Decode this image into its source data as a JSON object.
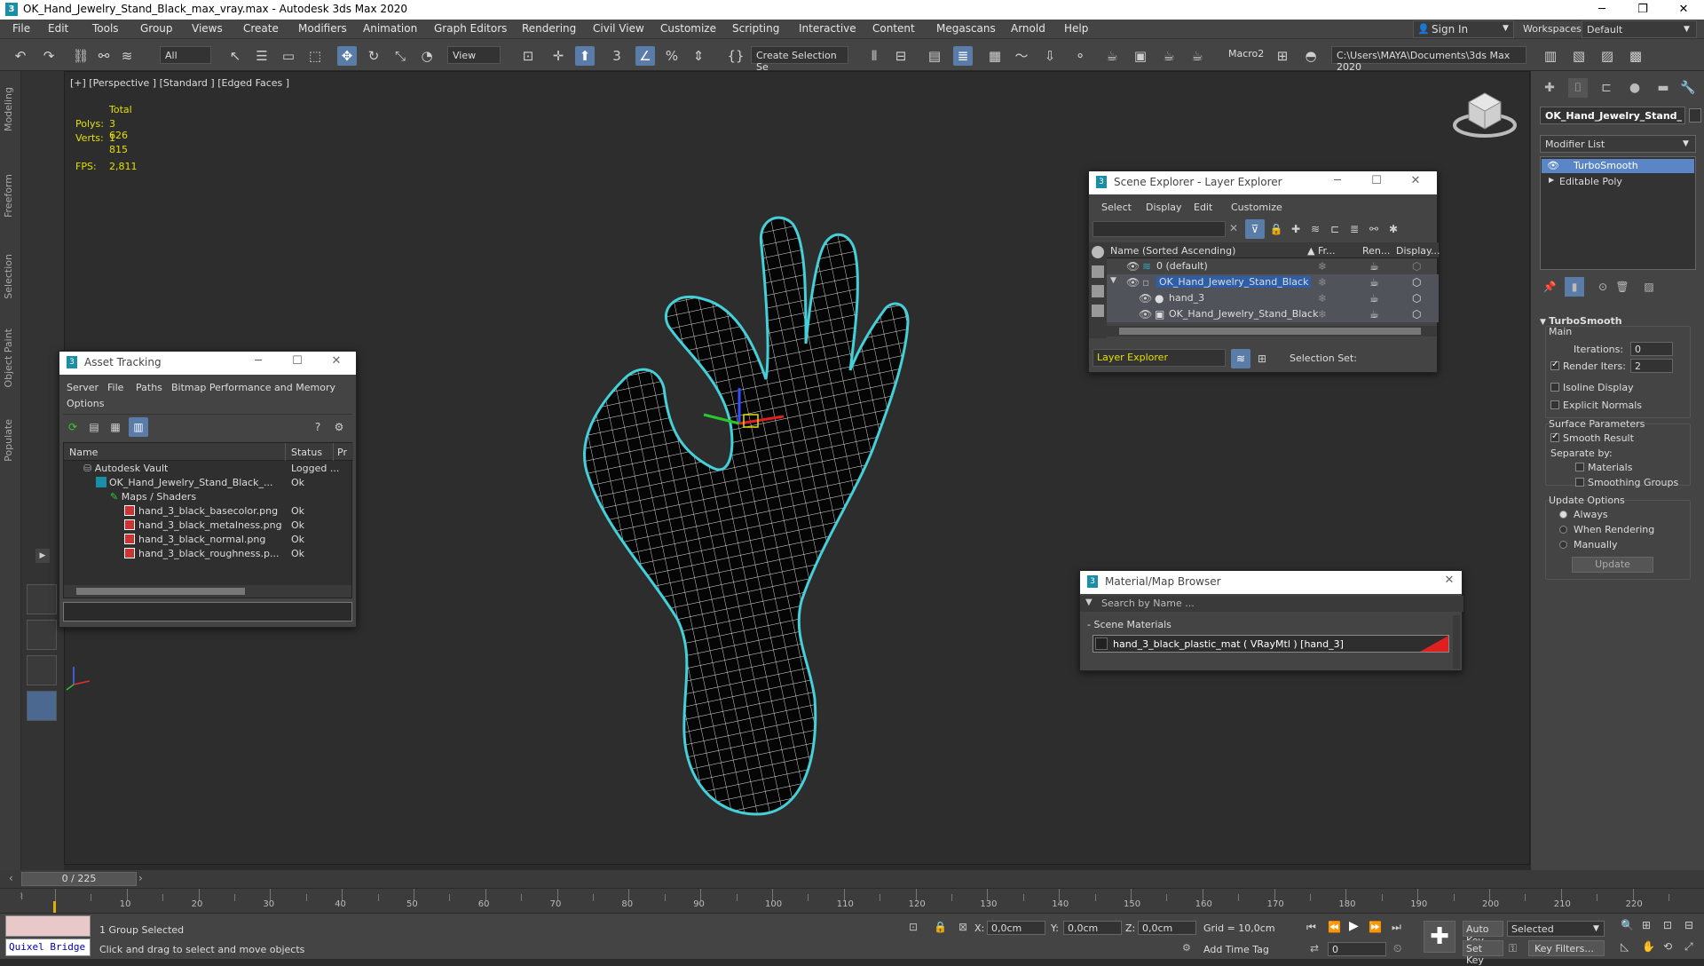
{
  "app": {
    "title": "OK_Hand_Jewelry_Stand_Black_max_vray.max - Autodesk 3ds Max 2020"
  },
  "window_controls": {
    "minimize": "─",
    "maximize": "❐",
    "close": "✕"
  },
  "menu": {
    "items": [
      "File",
      "Edit",
      "Tools",
      "Group",
      "Views",
      "Create",
      "Modifiers",
      "Animation",
      "Graph Editors",
      "Rendering",
      "Civil View",
      "Customize",
      "Scripting",
      "Interactive",
      "Content",
      "Megascans",
      "Arnold",
      "Help"
    ]
  },
  "account": {
    "signin": "Sign In",
    "workspaces_label": "Workspaces:",
    "workspace": "Default"
  },
  "toolbar": {
    "filter": "All",
    "refcoord": "View",
    "selset": "Create Selection Se",
    "macro": "Macro2",
    "path": "C:\\Users\\MAYA\\Documents\\3ds Max 2020"
  },
  "left_tabs": [
    "Modeling",
    "Freeform",
    "Selection",
    "Object Paint",
    "Populate"
  ],
  "viewport": {
    "label": "[+] [Perspective ] [Standard ] [Edged Faces ]",
    "stats": {
      "total": "Total",
      "polys_label": "Polys:",
      "polys": "3 626",
      "verts_label": "Verts:",
      "verts": "1 815",
      "fps_label": "FPS:",
      "fps": "2,811"
    }
  },
  "command_panel": {
    "object_name": "OK_Hand_Jewelry_Stand_",
    "modifier_list": "Modifier List",
    "stack": [
      "TurboSmooth",
      "Editable Poly"
    ],
    "rollout": {
      "title": "TurboSmooth",
      "main": "Main",
      "iterations_label": "Iterations:",
      "iterations": "0",
      "render_iters_label": "Render Iters:",
      "render_iters": "2",
      "isoline": "Isoline Display",
      "explicit": "Explicit Normals",
      "surface": "Surface Parameters",
      "smooth_result": "Smooth Result",
      "separate_by": "Separate by:",
      "materials": "Materials",
      "smoothing_groups": "Smoothing Groups",
      "update_options": "Update Options",
      "always": "Always",
      "when_rendering": "When Rendering",
      "manually": "Manually",
      "update": "Update"
    }
  },
  "asset_tracking": {
    "title": "Asset Tracking",
    "menu": [
      "Server",
      "File",
      "Paths",
      "Bitmap Performance and Memory",
      "Options"
    ],
    "columns": [
      "Name",
      "Status",
      "Pr"
    ],
    "rows": [
      {
        "name": "Autodesk Vault",
        "status": "Logged ..."
      },
      {
        "name": "OK_Hand_Jewelry_Stand_Black_...",
        "status": "Ok"
      },
      {
        "name": "Maps / Shaders",
        "status": ""
      },
      {
        "name": "hand_3_black_basecolor.png",
        "status": "Ok"
      },
      {
        "name": "hand_3_black_metalness.png",
        "status": "Ok"
      },
      {
        "name": "hand_3_black_normal.png",
        "status": "Ok"
      },
      {
        "name": "hand_3_black_roughness.p...",
        "status": "Ok"
      }
    ]
  },
  "scene_explorer": {
    "title": "Scene Explorer - Layer Explorer",
    "menu": [
      "Select",
      "Display",
      "Edit",
      "Customize"
    ],
    "columns": [
      "Name (Sorted Ascending)",
      "▲ Fr...",
      "Ren...",
      "Display..."
    ],
    "rows": [
      "0 (default)",
      "OK_Hand_Jewelry_Stand_Black",
      "hand_3",
      "OK_Hand_Jewelry_Stand_Black"
    ],
    "footer_dropdown": "Layer Explorer",
    "selection_set": "Selection Set:"
  },
  "material_browser": {
    "title": "Material/Map Browser",
    "search_placeholder": "Search by Name ...",
    "section": "- Scene Materials",
    "material": "hand_3_black_plastic_mat  ( VRayMtl )  [hand_3]"
  },
  "timeline": {
    "frame": "0 / 225",
    "ticks": [
      "10",
      "20",
      "30",
      "40",
      "50",
      "60",
      "70",
      "80",
      "90",
      "100",
      "110",
      "120",
      "130",
      "140",
      "150",
      "160",
      "170",
      "180",
      "190",
      "200",
      "210",
      "220"
    ]
  },
  "status": {
    "quixel": "Quixel Bridge",
    "selected": "1 Group Selected",
    "prompt": "Click and drag to select and move objects",
    "x_label": "X:",
    "x": "0,0cm",
    "y_label": "Y:",
    "y": "0,0cm",
    "z_label": "Z:",
    "z": "0,0cm",
    "grid": "Grid = 10,0cm",
    "add_time_tag": "Add Time Tag",
    "auto_key": "Auto Key",
    "selected_dd": "Selected",
    "set_key": "Set Key",
    "key_filters": "Key Filters...",
    "frame_field": "0"
  },
  "colors": {
    "accent": "#5a7ca8",
    "selection": "#43d0d8",
    "highlight": "#2e5ea8"
  }
}
